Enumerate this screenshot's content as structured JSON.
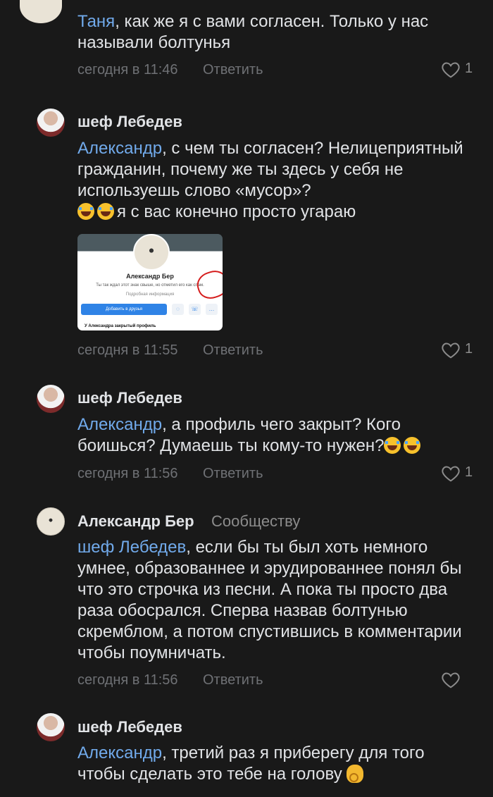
{
  "comments": [
    {
      "author": "",
      "mention": "Таня",
      "text": ", как же я с вами согласен. Только у нас называли болтунья",
      "time": "сегодня в 11:46",
      "reply": "Ответить",
      "likes": "1"
    },
    {
      "author": "шеф  Лебедев",
      "mention": "Александр",
      "text": ", с чем ты согласен? Нелицеприятный гражданин, почему же ты здесь у себя не используешь слово «мусор»?",
      "text_after_emoji": "я с вас конечно просто угараю",
      "time": "сегодня в 11:55",
      "reply": "Ответить",
      "likes": "1",
      "image": {
        "name": "Александр Бер",
        "status": "Ты так ждал этот знак свыше, но отметил его как спам.",
        "info": "Подробная информация",
        "button": "Добавить в друзья",
        "footer": "У Александра закрытый профиль"
      }
    },
    {
      "author": "шеф  Лебедев",
      "mention": "Александр",
      "text": ", а профиль чего закрыт? Кого боишься? Думаешь ты кому-то нужен?",
      "time": "сегодня в 11:56",
      "reply": "Ответить",
      "likes": "1"
    },
    {
      "author": "Александр Бер",
      "author_extra": "Сообществу",
      "mention": "шеф  Лебедев",
      "text": ", если бы ты был хоть немного умнее, образованнее и эрудированнее понял бы что это строчка из песни. А пока ты просто два раза обосрался. Сперва назвав болтунью скремблом, а потом спустившись в комментарии чтобы поумничать.",
      "time": "сегодня в 11:56",
      "reply": "Ответить",
      "likes": ""
    },
    {
      "author": "шеф  Лебедев",
      "mention": "Александр",
      "text": ", третий раз я приберегу для того чтобы сделать это тебе на голову",
      "time": "",
      "reply": "",
      "likes": ""
    }
  ],
  "icons": {
    "heart": "heart-outline-icon",
    "emoji": "laughing-emoji-icon",
    "ok": "ok-hand-emoji-icon"
  },
  "colors": {
    "background": "#191919",
    "text": "#e1e3e6",
    "muted": "#6f7175",
    "link": "#71aaeb"
  }
}
